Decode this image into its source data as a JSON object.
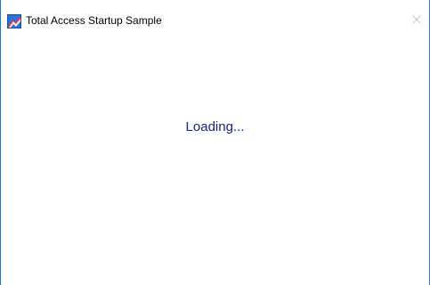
{
  "window": {
    "title": "Total Access Startup Sample",
    "icon": "app-icon",
    "close_icon": "close-icon"
  },
  "main": {
    "status_text": "Loading..."
  },
  "colors": {
    "status_text": "#1a237e",
    "window_border": "#3c6fa8",
    "background": "#ffffff"
  }
}
